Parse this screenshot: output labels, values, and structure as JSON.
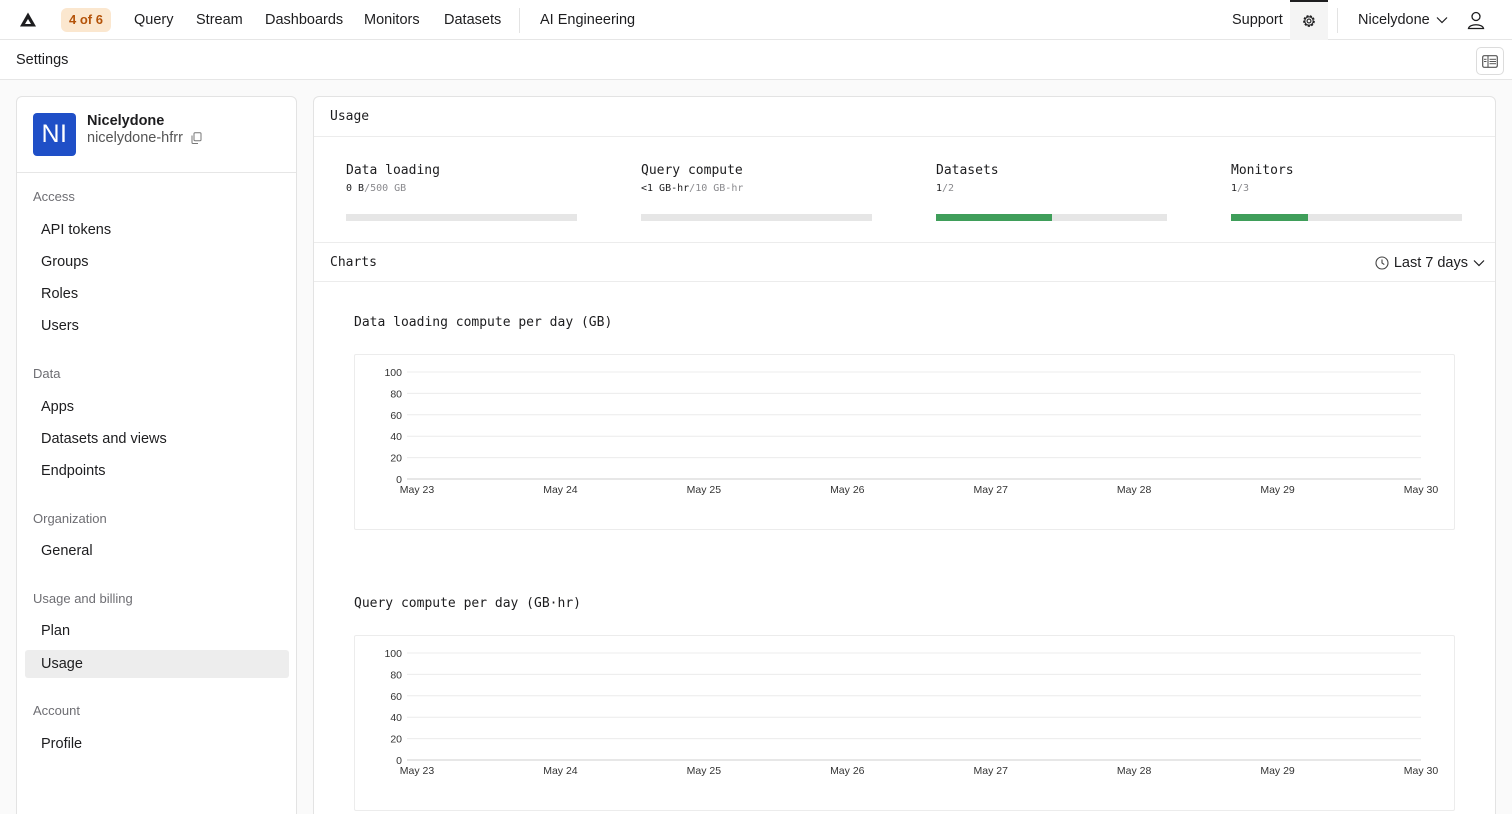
{
  "nav": {
    "badge": "4 of 6",
    "items": [
      "Query",
      "Stream",
      "Dashboards",
      "Monitors",
      "Datasets"
    ],
    "ai": "AI Engineering",
    "support": "Support",
    "org_menu": "Nicelydone"
  },
  "page": {
    "title": "Settings"
  },
  "sidebar": {
    "avatar_initials": "NI",
    "org_name": "Nicelydone",
    "org_slug": "nicelydone-hfrr",
    "sections": [
      {
        "title": "Access",
        "items": [
          "API tokens",
          "Groups",
          "Roles",
          "Users"
        ]
      },
      {
        "title": "Data",
        "items": [
          "Apps",
          "Datasets and views",
          "Endpoints"
        ]
      },
      {
        "title": "Organization",
        "items": [
          "General"
        ]
      },
      {
        "title": "Usage and billing",
        "items": [
          "Plan",
          "Usage"
        ]
      },
      {
        "title": "Account",
        "items": [
          "Profile"
        ]
      }
    ],
    "active": "Usage"
  },
  "usage": {
    "title": "Usage",
    "cards": [
      {
        "label": "Data loading",
        "value": "0 B",
        "limit": "/500 GB",
        "fraction": 0
      },
      {
        "label": "Query compute",
        "value": "<1 GB-hr",
        "limit": "/10 GB-hr",
        "fraction": 0
      },
      {
        "label": "Datasets",
        "value": "1",
        "limit": "/2",
        "fraction": 0.5
      },
      {
        "label": "Monitors",
        "value": "1",
        "limit": "/3",
        "fraction": 0.3333
      }
    ]
  },
  "charts_panel": {
    "title": "Charts",
    "range": "Last 7 days"
  },
  "chart_data": [
    {
      "type": "line",
      "title": "Data loading compute per day (GB)",
      "categories": [
        "May 23",
        "May 24",
        "May 25",
        "May 26",
        "May 27",
        "May 28",
        "May 29",
        "May 30"
      ],
      "yticks": [
        0,
        20,
        40,
        60,
        80,
        100
      ],
      "ylim": [
        0,
        100
      ],
      "values": [],
      "grid": true
    },
    {
      "type": "line",
      "title": "Query compute per day (GB·hr)",
      "categories": [
        "May 23",
        "May 24",
        "May 25",
        "May 26",
        "May 27",
        "May 28",
        "May 29",
        "May 30"
      ],
      "yticks": [
        0,
        20,
        40,
        60,
        80,
        100
      ],
      "ylim": [
        0,
        100
      ],
      "values": [],
      "grid": true
    }
  ]
}
